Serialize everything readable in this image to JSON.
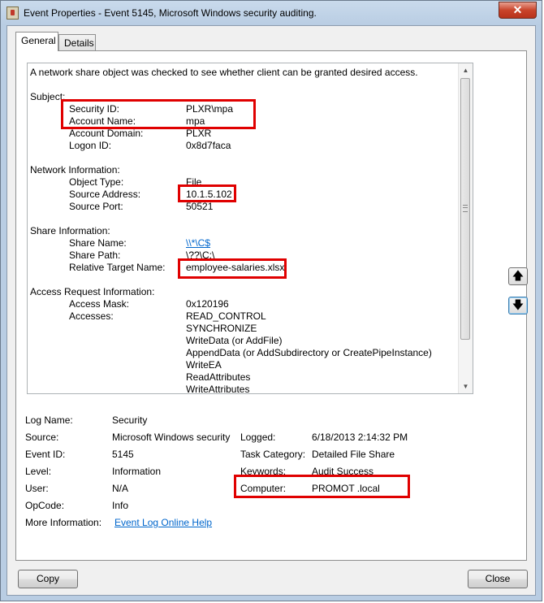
{
  "window": {
    "title": "Event Properties - Event 5145, Microsoft Windows security auditing.",
    "close_glyph": "✕"
  },
  "tabs": [
    {
      "label": "General",
      "active": true
    },
    {
      "label": "Details",
      "active": false
    }
  ],
  "description": {
    "intro": "A network share object was checked to see whether client can be granted desired access.",
    "subject": {
      "heading": "Subject:",
      "rows": [
        {
          "label": "Security ID:",
          "value": "PLXR\\mpa"
        },
        {
          "label": "Account Name:",
          "value": "mpa"
        },
        {
          "label": "Account Domain:",
          "value": "PLXR"
        },
        {
          "label": "Logon ID:",
          "value": "0x8d7faca"
        }
      ]
    },
    "network": {
      "heading": "Network Information:",
      "rows": [
        {
          "label": "Object Type:",
          "value": "File"
        },
        {
          "label": "Source Address:",
          "value": "10.1.5.102"
        },
        {
          "label": "Source Port:",
          "value": "50521"
        }
      ]
    },
    "share": {
      "heading": "Share Information:",
      "rows": [
        {
          "label": "Share Name:",
          "value": "\\\\*\\C$"
        },
        {
          "label": "Share Path:",
          "value": "\\??\\C:\\"
        },
        {
          "label": "Relative Target Name:",
          "value": "employee-salaries.xlsx"
        }
      ]
    },
    "access": {
      "heading": "Access Request Information:",
      "mask_label": "Access Mask:",
      "mask_value": "0x120196",
      "accesses_label": "Accesses:",
      "accesses": [
        "READ_CONTROL",
        "SYNCHRONIZE",
        "WriteData (or AddFile)",
        "AppendData (or AddSubdirectory or CreatePipeInstance)",
        "WriteEA",
        "ReadAttributes",
        "WriteAttributes"
      ]
    }
  },
  "properties": {
    "log_name_label": "Log Name:",
    "log_name": "Security",
    "source_label": "Source:",
    "source": "Microsoft Windows security",
    "logged_label": "Logged:",
    "logged": "6/18/2013 2:14:32 PM",
    "event_id_label": "Event ID:",
    "event_id": "5145",
    "task_category_label": "Task Category:",
    "task_category": "Detailed File Share",
    "level_label": "Level:",
    "level": "Information",
    "keywords_label": "Keywords:",
    "keywords": "Audit Success",
    "user_label": "User:",
    "user": "N/A",
    "computer_label": "Computer:",
    "computer": "PROMOT    .local",
    "opcode_label": "OpCode:",
    "opcode": "Info",
    "more_info_label": "More Information:",
    "more_info_link": "Event Log Online Help"
  },
  "nav": {
    "up_glyph": "🡅",
    "down_glyph": "🡇"
  },
  "buttons": {
    "copy": "Copy",
    "close": "Close"
  },
  "colors": {
    "highlight": "#e00000",
    "link": "#0066cc"
  }
}
